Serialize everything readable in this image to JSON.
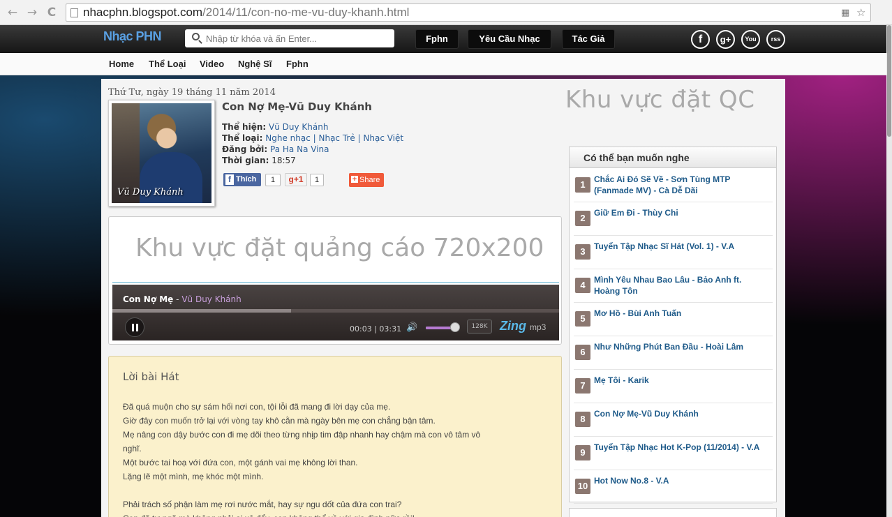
{
  "browser": {
    "url_domain": "nhacphn.blogspot.com",
    "url_path": "/2014/11/con-no-me-vu-duy-khanh.html",
    "back_glyph": "←",
    "forward_glyph": "→",
    "reload_glyph": "C",
    "star_glyph": "☆"
  },
  "header": {
    "logo": "Nhạc PHN",
    "search_placeholder": "Nhập từ khóa và ấn Enter...",
    "buttons": [
      "Fphn",
      "Yêu Cầu Nhạc",
      "Tác Giả"
    ],
    "social": [
      "f",
      "g+",
      "You",
      "rss"
    ]
  },
  "menu": [
    "Home",
    "Thể Loại",
    "Video",
    "Nghệ Sĩ",
    "Fphn"
  ],
  "post": {
    "date": "Thứ Tư, ngày 19 tháng 11 năm 2014",
    "cover_caption": "Vũ Duy Khánh",
    "title": "Con Nợ Mẹ-Vũ Duy Khánh",
    "meta": {
      "artist_label": "Thể hiện:",
      "artist": "Vũ Duy Khánh",
      "genre_label": "Thể loại:",
      "genres": "Nghe nhạc | Nhạc Trẻ | Nhạc Việt",
      "poster_label": "Đăng bởi:",
      "poster": "Pa Ha Na Vina",
      "time_label": "Thời gian:",
      "time": "18:57"
    },
    "share": {
      "like_label": "Thích",
      "like_count": "1",
      "gplus_label": "g+1",
      "gplus_count": "1",
      "share_label": "Share"
    }
  },
  "ads": {
    "side": "Khu vực đặt QC",
    "main": "Khu vực đặt quảng cáo 720x200"
  },
  "player": {
    "song": "Con Nợ Mẹ",
    "separator": "-",
    "artist": "Vũ Duy Khánh",
    "time": "00:03 | 03:31",
    "progress_pct": 40,
    "volume_pct": 85,
    "quality": "128K",
    "brand": "Zing",
    "brand_suffix": "mp3"
  },
  "lyrics": {
    "title": "Lời bài Hát",
    "lines": [
      "Đã quá muộn cho sự sám hối nơi con, tội lỗi đã mang đi lời dạy của mẹ.",
      "Giờ đây con muốn trở lại với vòng tay khô cằn mà ngày bên mẹ con chẳng bận tâm.",
      "Mẹ nâng con dậy bước con đi mẹ dõi theo từng nhịp tim đập nhanh hay chậm mà con vô tâm vô",
      "nghĩ.",
      "Một bước tai hoạ với đứa con, một gánh vai mẹ không lời than.",
      "Lặng lẽ một mình, mẹ khóc một mình.",
      "",
      "Phải trách số phận làm mẹ rơi nước mắt, hay sự ngu dốt của đứa con trai?",
      "Con đã tự ngã mà không phải ai xô đẩy, con không thể về với gia đình nữa rồi!"
    ]
  },
  "sidebar": {
    "title": "Có thể bạn muốn nghe",
    "items": [
      {
        "num": "1",
        "text": "Chắc Ai Đó Sẽ Về - Sơn Tùng MTP (Fanmade MV) - Cà Dễ Dãi"
      },
      {
        "num": "2",
        "text": "Giữ Em Đi - Thùy Chi"
      },
      {
        "num": "3",
        "text": "Tuyển Tập Nhạc Sĩ Hát (Vol. 1) - V.A"
      },
      {
        "num": "4",
        "text": "Mình Yêu Nhau Bao Lâu - Bảo Anh ft. Hoàng Tôn"
      },
      {
        "num": "5",
        "text": "Mơ Hồ - Bùi Anh Tuấn"
      },
      {
        "num": "6",
        "text": "Như Những Phút Ban Đầu - Hoài Lâm"
      },
      {
        "num": "7",
        "text": "Mẹ Tôi - Karik"
      },
      {
        "num": "8",
        "text": "Con Nợ Mẹ-Vũ Duy Khánh"
      },
      {
        "num": "9",
        "text": "Tuyển Tập Nhạc Hot K-Pop (11/2014) - V.A"
      },
      {
        "num": "10",
        "text": "Hot Now No.8 - V.A"
      }
    ]
  }
}
